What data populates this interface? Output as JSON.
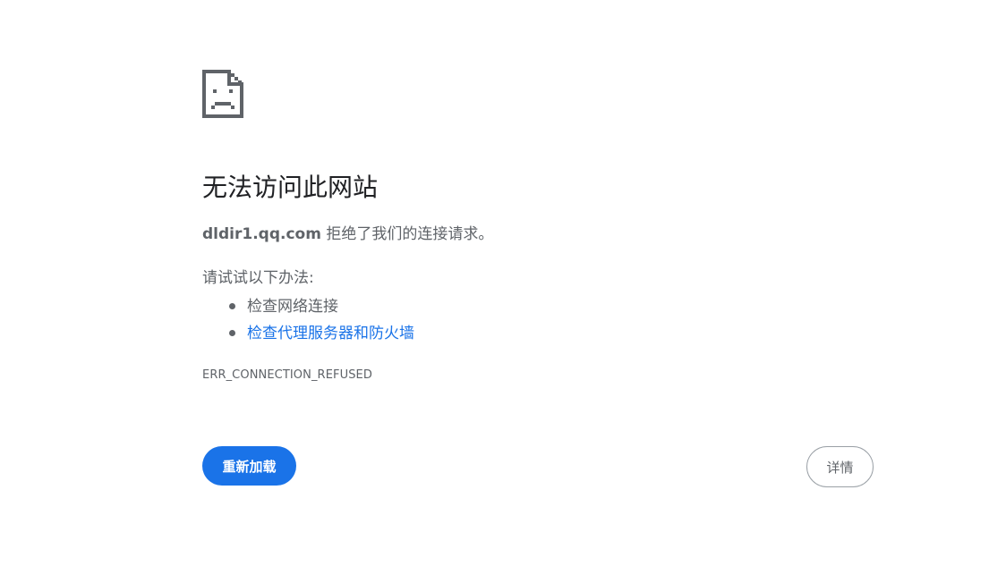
{
  "icon": {
    "name": "sad-page-icon",
    "color": "#5f6368"
  },
  "title": "无法访问此网站",
  "summary": {
    "host": "dldir1.qq.com",
    "message": " 拒绝了我们的连接请求。"
  },
  "suggestions": {
    "heading": "请试试以下办法:",
    "items": [
      {
        "label": "检查网络连接",
        "link": false
      },
      {
        "label": "检查代理服务器和防火墙",
        "link": true
      }
    ]
  },
  "error_code": "ERR_CONNECTION_REFUSED",
  "buttons": {
    "reload_label": "重新加载",
    "details_label": "详情"
  },
  "colors": {
    "accent": "#1a73e8",
    "text_secondary": "#5f6368",
    "title": "#202124"
  }
}
